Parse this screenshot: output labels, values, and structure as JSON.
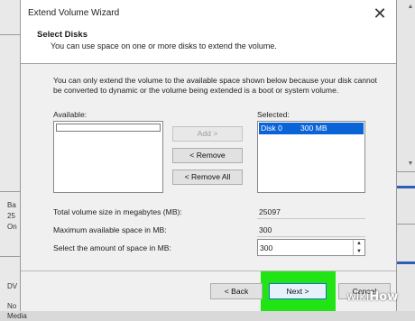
{
  "wizard": {
    "title": "Extend Volume Wizard",
    "close_glyph": "✕",
    "header_title": "Select Disks",
    "header_subtitle": "You can use space on one or more disks to extend the volume.",
    "info_text": "You can only extend the volume to the available space shown below because your disk cannot be converted to dynamic or the volume being extended is a boot or system volume.",
    "available_label": "Available:",
    "selected_label": "Selected:",
    "selected_items": [
      {
        "disk": "Disk 0",
        "size": "300 MB"
      }
    ],
    "buttons": {
      "add": "Add >",
      "remove": "< Remove",
      "remove_all": "< Remove All",
      "back": "< Back",
      "next": "Next >",
      "cancel": "Cancel"
    },
    "fields": {
      "total_label": "Total volume size in megabytes (MB):",
      "total_value": "25097",
      "max_label": "Maximum available space in MB:",
      "max_value": "300",
      "select_label": "Select the amount of space in MB:",
      "select_value": "300"
    }
  },
  "background": {
    "left_fragments": [
      "Ba",
      "25",
      "On",
      "DV",
      "No Media"
    ]
  },
  "watermark": {
    "prefix": "wiki",
    "suffix": "How"
  },
  "colors": {
    "highlight": "#21e414",
    "selection": "#0a64d7"
  }
}
